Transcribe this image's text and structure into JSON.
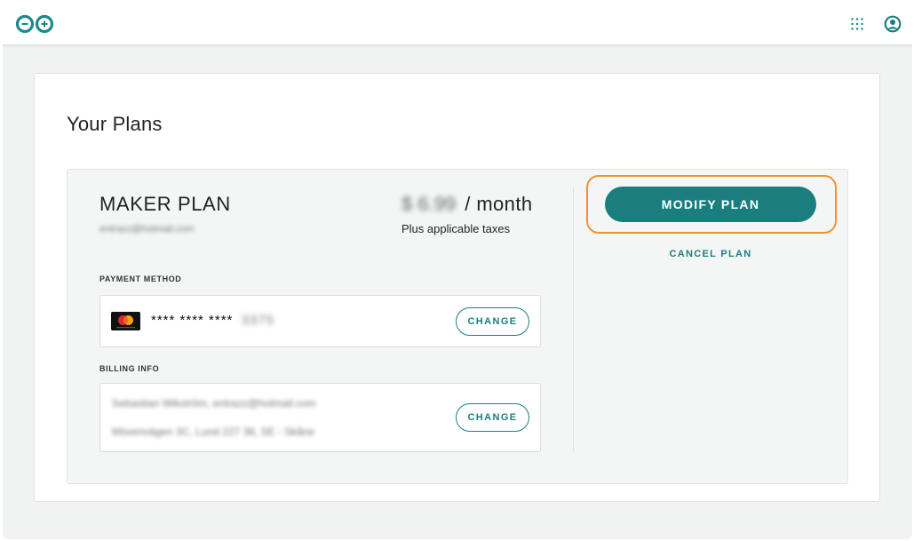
{
  "header": {
    "logo_icon": "arduino-infinity-logo",
    "apps_icon": "grid-apps-icon",
    "user_icon": "user-account-icon",
    "accent_color": "#1a7e7f"
  },
  "page": {
    "title": "Your Plans"
  },
  "plan": {
    "name": "MAKER PLAN",
    "email": "entrazz@hotmail.com",
    "price_amount": "$ 6.99",
    "price_period": "/ month",
    "price_note": "Plus applicable taxes"
  },
  "payment": {
    "label": "PAYMENT METHOD",
    "card_icon": "mastercard-icon",
    "card_masked": "**** **** ****",
    "card_last4": "3375",
    "change_label": "CHANGE"
  },
  "billing": {
    "label": "BILLING INFO",
    "line1": "Sebastian Wikström, entrazz@hotmail.com",
    "line2": "Mövenvägen 3C, Lund 227 38, SE - Skåne",
    "change_label": "CHANGE"
  },
  "actions": {
    "modify_label": "MODIFY PLAN",
    "cancel_label": "CANCEL PLAN",
    "highlight_color": "#f0922b"
  }
}
